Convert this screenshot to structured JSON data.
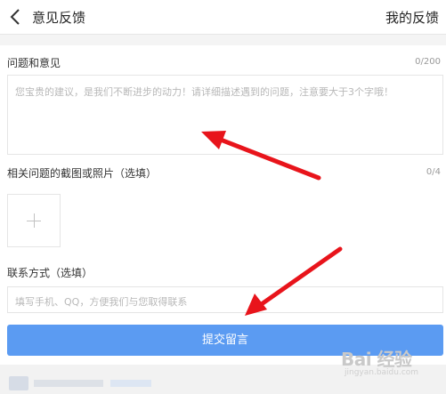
{
  "header": {
    "title": "意见反馈",
    "my_feedback": "我的反馈"
  },
  "issue": {
    "label": "问题和意见",
    "counter": "0/200",
    "placeholder": "您宝贵的建议，是我们不断进步的动力！请详细描述遇到的问题，注意要大于3个字哦！"
  },
  "screenshots": {
    "label": "相关问题的截图或照片（选填）",
    "counter": "0/4"
  },
  "contact": {
    "label": "联系方式（选填）",
    "placeholder": "填写手机、QQ，方便我们与您取得联系"
  },
  "submit_label": "提交留言",
  "watermark": {
    "brand": "Bai 经验",
    "sub": "jingyan.baidu.com"
  },
  "colors": {
    "accent": "#5b9bf2",
    "arrow": "#e8141b"
  }
}
